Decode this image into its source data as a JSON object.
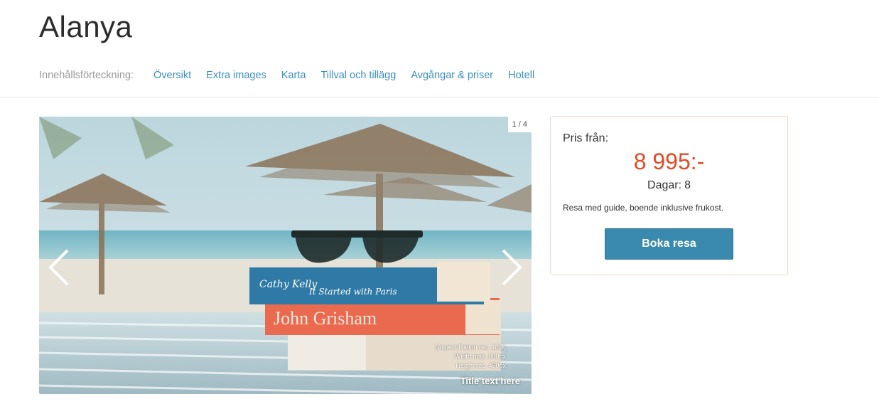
{
  "page": {
    "title": "Alanya"
  },
  "toc": {
    "label": "Innehållsförteckning:",
    "links": [
      "Översikt",
      "Extra images",
      "Karta",
      "Tillval och tillägg",
      "Avgångar & priser",
      "Hotell"
    ]
  },
  "slider": {
    "counter": "1 / 4",
    "note_lines": [
      "(Aspect Ration rec. 16:9)",
      "Width max. 800px",
      "Height rec. 450px"
    ],
    "caption": "Title text here",
    "book_texts": [
      "Cathy Kelly",
      "It Started with Paris",
      "John Grisham"
    ]
  },
  "price_box": {
    "label": "Pris från:",
    "price": "8 995:-",
    "days_label": "Dagar:",
    "days_value": "8",
    "description": "Resa med guide, boende inklusive frukost.",
    "button_label": "Boka resa"
  },
  "colors": {
    "link": "#3a8ec2",
    "price": "#e34a26",
    "button": "#3a8ab0"
  }
}
